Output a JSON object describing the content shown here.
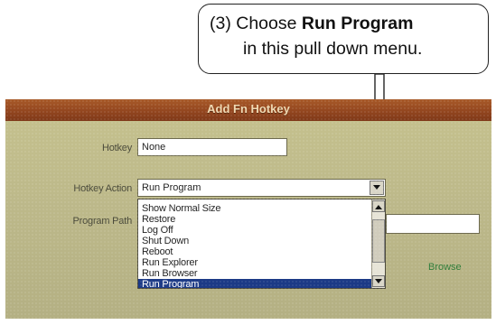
{
  "callout": {
    "prefix": "(3)  Choose ",
    "bold": "Run Program",
    "line2": "in this pull down menu."
  },
  "dialog": {
    "title": "Add Fn Hotkey",
    "hotkey_label": "Hotkey",
    "hotkey_value": "None",
    "action_label": "Hotkey Action",
    "action_value": "Run Program",
    "path_label": "Program Path",
    "path_value": "",
    "browse_label": "Browse"
  },
  "dropdown": {
    "options": [
      "Show Normal Size",
      "Restore",
      "Log Off",
      "Shut Down",
      "Reboot",
      "Run Explorer",
      "Run Browser",
      "Run Program"
    ],
    "selected": "Run Program"
  },
  "icons": {
    "arrow": "down-arrow-icon",
    "combo": "chevron-down-icon",
    "scroll_up": "scroll-up-icon",
    "scroll_down": "scroll-down-icon"
  }
}
